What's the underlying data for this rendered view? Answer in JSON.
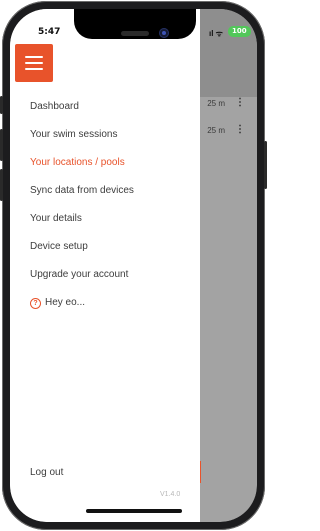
{
  "status_bar": {
    "time": "5:47",
    "battery": "100"
  },
  "background": {
    "rows": [
      {
        "distance": "25 m"
      },
      {
        "distance": "25 m"
      }
    ]
  },
  "drawer": {
    "menu_items": [
      {
        "label": "Dashboard",
        "active": false
      },
      {
        "label": "Your swim sessions",
        "active": false
      },
      {
        "label": "Your locations / pools",
        "active": true
      },
      {
        "label": "Sync data from devices",
        "active": false
      },
      {
        "label": "Your details",
        "active": false
      },
      {
        "label": "Device setup",
        "active": false
      },
      {
        "label": "Upgrade your account",
        "active": false
      }
    ],
    "help": {
      "icon": "question-circle-icon",
      "label": "Hey eo..."
    },
    "logout_label": "Log out",
    "version": "V1.4.0"
  },
  "colors": {
    "accent": "#e8532b",
    "battery": "#52c75a"
  }
}
